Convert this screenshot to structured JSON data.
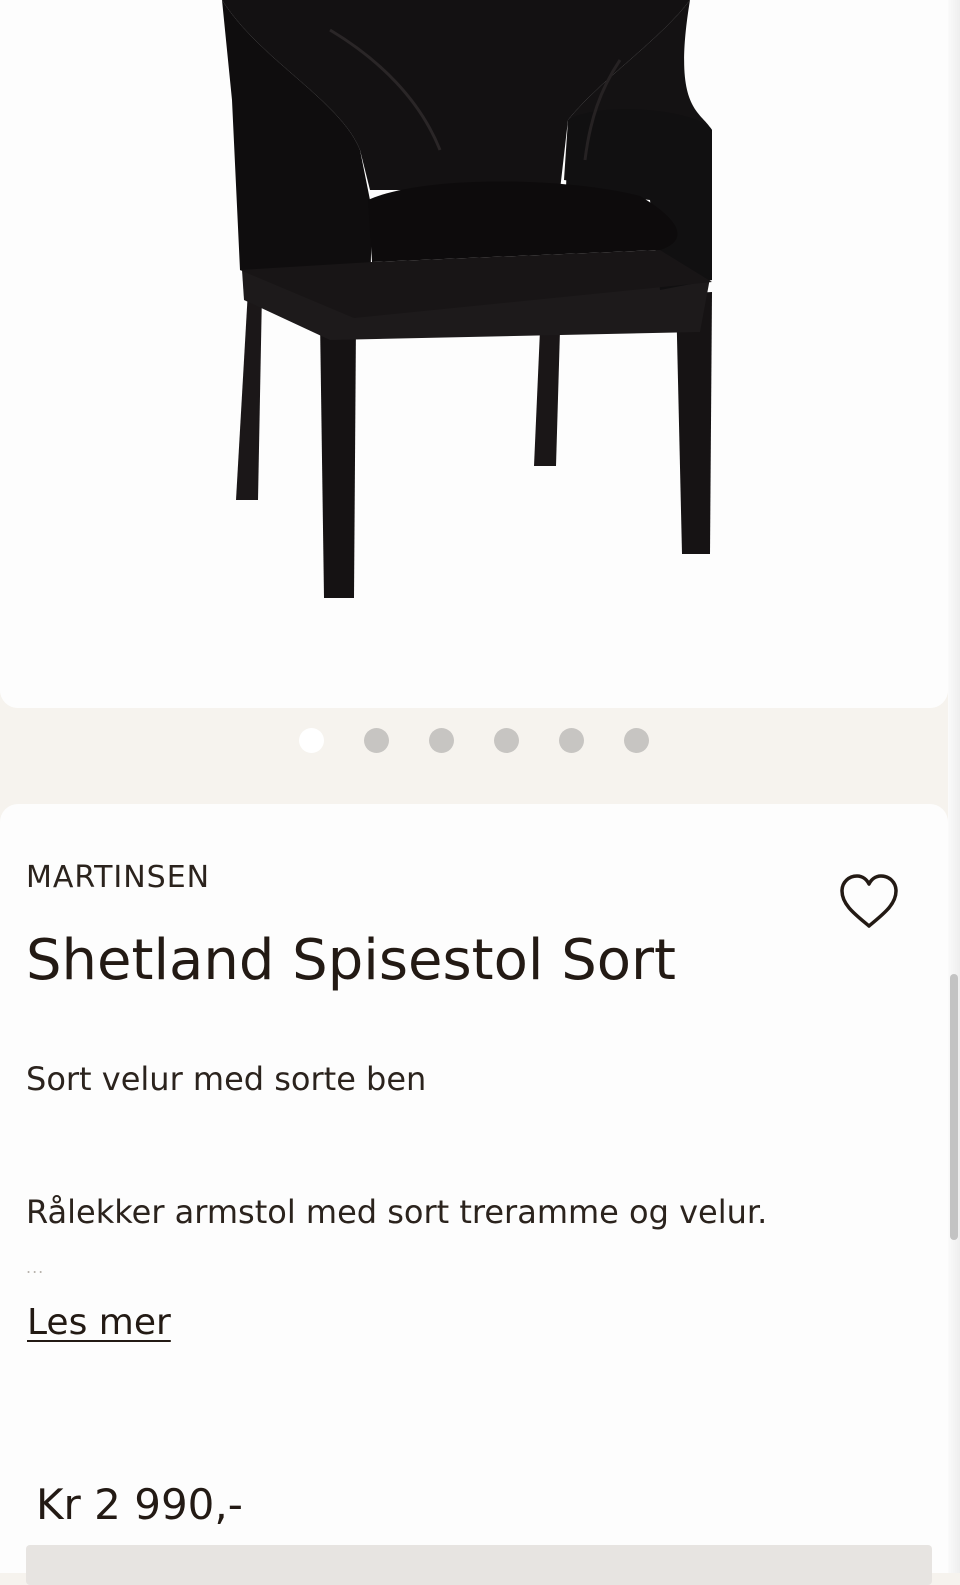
{
  "gallery": {
    "image_alt": "Shetland Spisestol Sort",
    "slide_count": 6,
    "active_slide": 1
  },
  "product": {
    "brand": "MARTINSEN",
    "title": "Shetland Spisestol Sort",
    "subtitle": "Sort velur med sorte ben",
    "description": "Rålekker armstol med sort treramme og velur.",
    "ellipsis": "...",
    "read_more": "Les mer",
    "price": "Kr 2 990,-"
  },
  "icons": {
    "favorite": "heart-outline-icon"
  },
  "colors": {
    "page_background": "#f6f3ee",
    "card_background": "#fdfdfd",
    "text": "#231a14",
    "dot_inactive": "#c7c5c2",
    "dot_active": "#ffffff"
  }
}
